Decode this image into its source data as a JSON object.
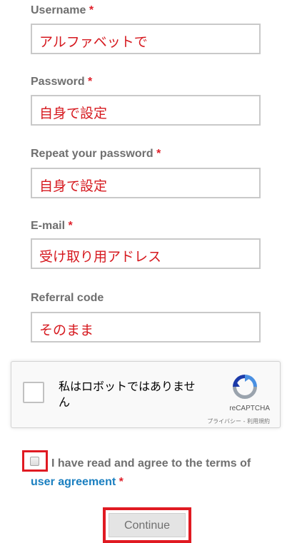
{
  "form": {
    "username": {
      "label": "Username",
      "required": "*",
      "value": "アルファベットで"
    },
    "password": {
      "label": "Password",
      "required": "*",
      "value": "自身で設定"
    },
    "repeat_password": {
      "label": "Repeat your password",
      "required": "*",
      "value": "自身で設定"
    },
    "email": {
      "label": "E-mail",
      "required": "*",
      "value": "受け取り用アドレス"
    },
    "referral": {
      "label": "Referral code",
      "value": "そのまま"
    }
  },
  "recaptcha": {
    "label": "私はロボットではありません",
    "brand": "reCAPTCHA",
    "links": "プライバシー - 利用規約"
  },
  "agreement": {
    "text": "I have read and agree to the terms of",
    "link": "user agreement",
    "required": "*"
  },
  "continue_label": "Continue",
  "colors": {
    "label": "#6f6f6f",
    "required": "#e0202a",
    "annotation_red": "#e01a22",
    "link": "#1a7fc0",
    "field_text": "#d6191f"
  }
}
